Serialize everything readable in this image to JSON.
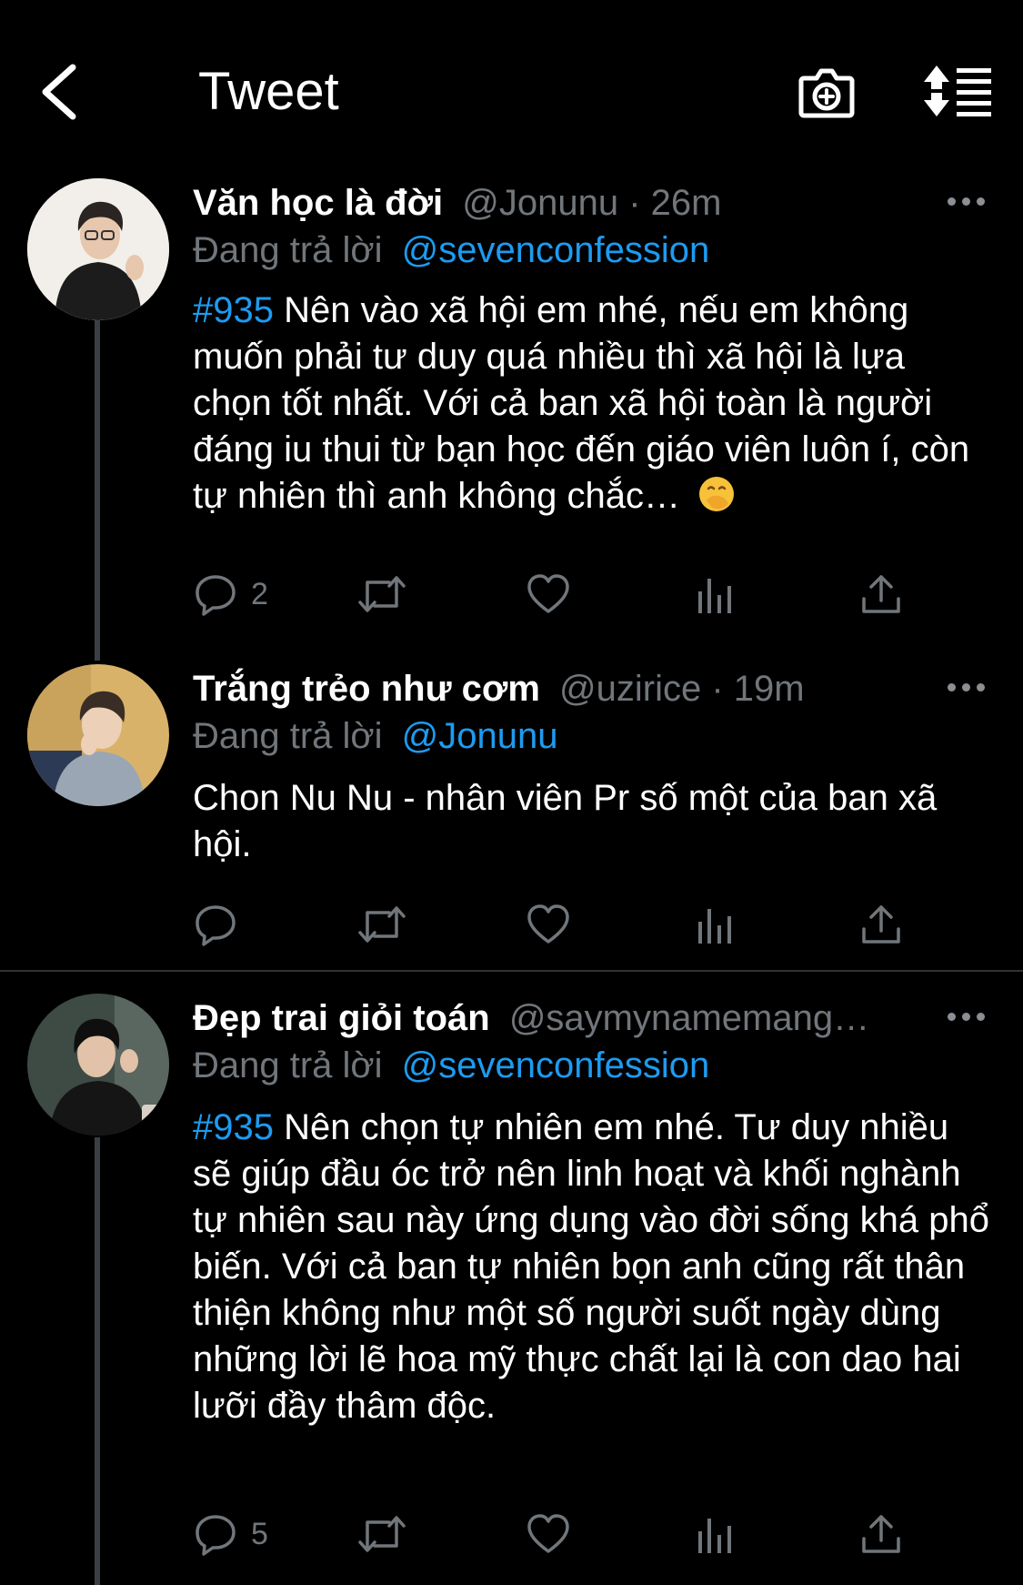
{
  "header": {
    "title": "Tweet",
    "back_icon": "chevron-left-icon",
    "camera_icon": "camera-add-icon",
    "sort_icon": "sort-icon"
  },
  "tweets": [
    {
      "display_name": "Văn học là đời",
      "handle_time": "@Jonunu · 26m",
      "reply_prefix": "Đang trả lời",
      "reply_to": "@sevenconfession",
      "hashtag": "#935",
      "text": "Nên vào xã hội em nhé, nếu em không muốn phải tư duy quá nhiều thì xã hội là lựa chọn tốt nhất. Với cả ban xã hội toàn là người đáng iu thui từ bạn học đến giáo viên luôn í, còn tự nhiên thì anh không chắc…",
      "emoji": "face-with-hand-over-mouth",
      "reply_count": "2"
    },
    {
      "display_name": "Trắng trẻo như cơm",
      "handle_time": "@uzirice · 19m",
      "reply_prefix": "Đang trả lời",
      "reply_to": "@Jonunu",
      "text": "Chon Nu Nu - nhân viên Pr số một của ban xã hội.",
      "reply_count": ""
    },
    {
      "display_name": "Đẹp trai giỏi toán",
      "handle_time": "@saymynamemang…",
      "reply_prefix": "Đang trả lời",
      "reply_to": "@sevenconfession",
      "hashtag": "#935",
      "text": "Nên chọn tự nhiên em nhé. Tư duy nhiều sẽ giúp đầu óc trở nên linh hoạt và khối nghành tự nhiên sau này ứng dụng vào đời sống khá phổ biến. Với cả ban tự nhiên bọn anh cũng rất thân thiện không như một số người suốt ngày dùng những lời lẽ hoa mỹ thực chất lại là con dao hai lưỡi đầy thâm độc.",
      "reply_count": "5"
    }
  ],
  "action_icons": [
    "reply-icon",
    "retweet-icon",
    "like-icon",
    "analytics-icon",
    "share-icon"
  ],
  "colors": {
    "background": "#000000",
    "text": "#ffffff",
    "muted": "#71767b",
    "accent": "#1d9bf0",
    "thread_line": "#3b3f44",
    "divider": "#2f3336"
  }
}
